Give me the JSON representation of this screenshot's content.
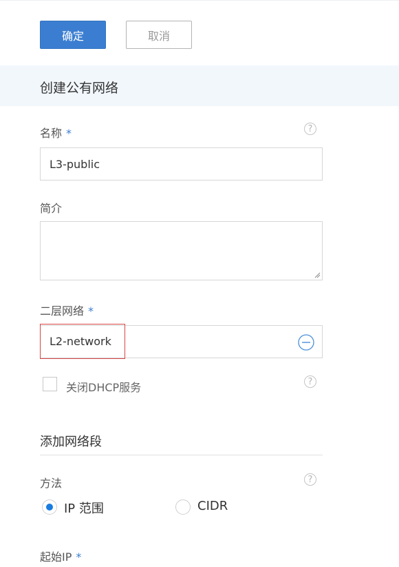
{
  "actions": {
    "confirm_label": "确定",
    "cancel_label": "取消"
  },
  "section": {
    "title": "创建公有网络"
  },
  "name_field": {
    "label": "名称",
    "required_mark": "*",
    "value": "L3-public"
  },
  "description_field": {
    "label": "简介",
    "value": ""
  },
  "l2_network": {
    "label": "二层网络",
    "required_mark": "*",
    "value": "L2-network"
  },
  "dhcp": {
    "label": "关闭DHCP服务",
    "checked": false
  },
  "ip_range_section": {
    "title": "添加网络段"
  },
  "method": {
    "label": "方法",
    "options": [
      {
        "label": "IP 范围",
        "selected": true
      },
      {
        "label": "CIDR",
        "selected": false
      }
    ]
  },
  "start_ip": {
    "label": "起始IP",
    "required_mark": "*"
  },
  "colors": {
    "primary": "#3b7ed1",
    "highlight_border": "#d64545",
    "radio_selected": "#1a7ce0",
    "section_band": "#f2f7fc"
  }
}
